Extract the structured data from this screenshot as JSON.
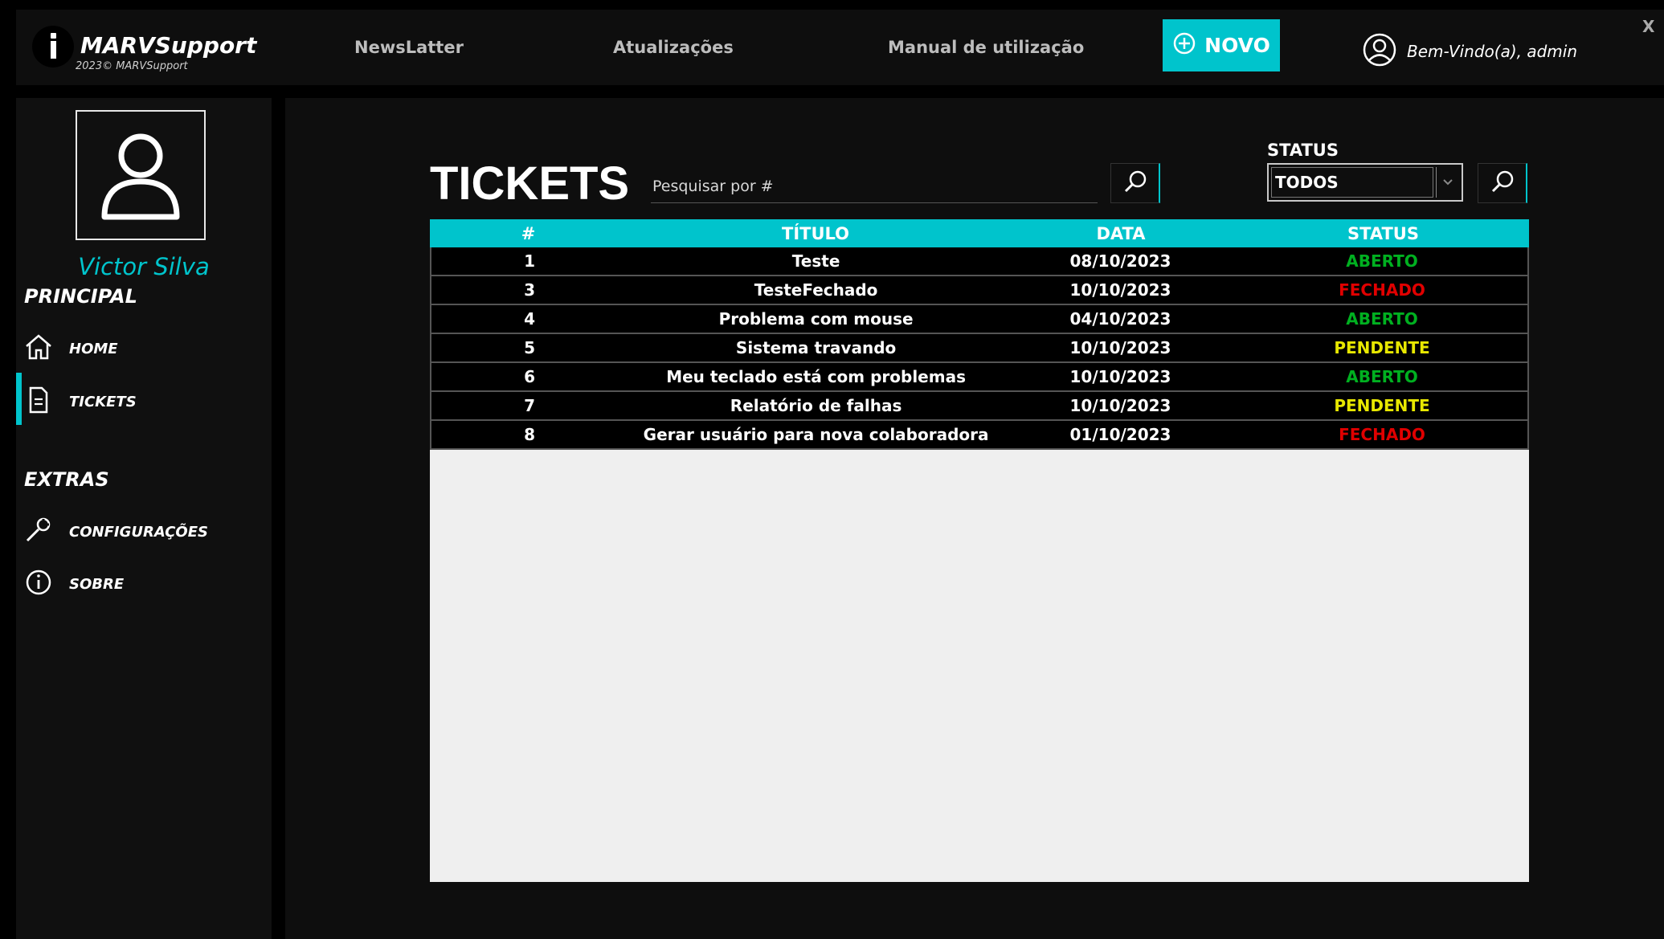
{
  "app": {
    "title": "MARVSupport",
    "copyright": "2023© MARVSupport",
    "close_label": "X"
  },
  "nav": {
    "links": [
      "NewsLatter",
      "Atualizações",
      "Manual de utilização"
    ],
    "novo_label": "NOVO",
    "welcome": "Bem-Vindo(a), admin"
  },
  "sidebar": {
    "user_name": "Victor Silva",
    "principal_title": "PRINCIPAL",
    "home_label": "HOME",
    "tickets_label": "TICKETS",
    "extras_title": "EXTRAS",
    "config_label": "CONFIGURAÇÕES",
    "sobre_label": "SOBRE"
  },
  "main": {
    "title": "TICKETS",
    "search_placeholder": "Pesquisar por #",
    "status_label": "STATUS",
    "status_selected": "TODOS"
  },
  "table": {
    "headers": [
      "#",
      "TÍTULO",
      "DATA",
      "STATUS"
    ],
    "rows": [
      {
        "id": "1",
        "title": "Teste",
        "date": "08/10/2023",
        "status": "ABERTO"
      },
      {
        "id": "3",
        "title": "TesteFechado",
        "date": "10/10/2023",
        "status": "FECHADO"
      },
      {
        "id": "4",
        "title": "Problema com mouse",
        "date": "04/10/2023",
        "status": "ABERTO"
      },
      {
        "id": "5",
        "title": "Sistema travando",
        "date": "10/10/2023",
        "status": "PENDENTE"
      },
      {
        "id": "6",
        "title": "Meu teclado está com problemas",
        "date": "10/10/2023",
        "status": "ABERTO"
      },
      {
        "id": "7",
        "title": "Relatório de falhas",
        "date": "10/10/2023",
        "status": "PENDENTE"
      },
      {
        "id": "8",
        "title": "Gerar usuário para nova colaboradora",
        "date": "01/10/2023",
        "status": "FECHADO"
      }
    ]
  },
  "colors": {
    "accent": "#00c4cc",
    "ABERTO": "#00b020",
    "FECHADO": "#e00000",
    "PENDENTE": "#e8e800"
  }
}
